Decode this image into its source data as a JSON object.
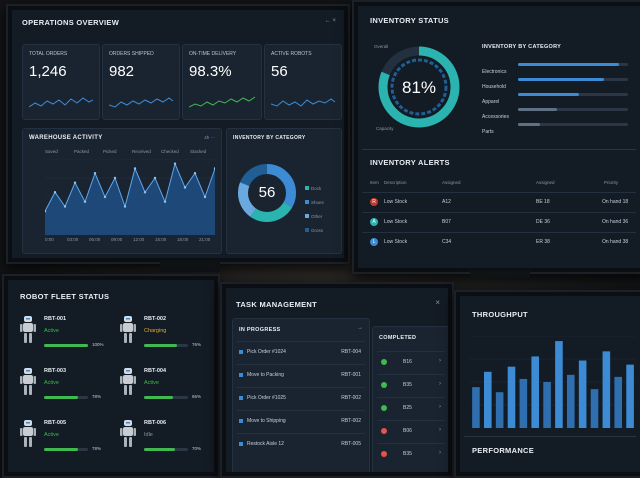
{
  "ops": {
    "title": "Operations Overview",
    "window_controls": "← ×",
    "kpis": [
      {
        "label": "Total Orders",
        "value": "1,246"
      },
      {
        "label": "Orders Shipped",
        "value": "982"
      },
      {
        "label": "On-Time Delivery",
        "value": "98.3%"
      },
      {
        "label": "Active Robots",
        "value": "56"
      }
    ],
    "activity_title": "Warehouse Activity",
    "activity_controls": "4h ⋯",
    "activity_legend": [
      "Saved",
      "Packed",
      "Picked",
      "Received",
      "Checked",
      "Stacked"
    ],
    "activity_x": [
      "0:00",
      "03:00",
      "06:00",
      "09:00",
      "12:00",
      "15:00",
      "18:00",
      "21:00"
    ],
    "activity_series": [
      5,
      9,
      6,
      11,
      7,
      13,
      8,
      12,
      6,
      14,
      9,
      12,
      7,
      15,
      10,
      13,
      8,
      14
    ],
    "donut_title": "Inventory by Category",
    "donut_value": "56",
    "donut_legend": [
      "Dock",
      "Shoes",
      "Other",
      "Gross"
    ]
  },
  "inventory": {
    "title": "Inventory Status",
    "gauge_value": "81%",
    "gauge_percent": 81,
    "gauge_top_label": "Overall",
    "gauge_bottom_label": "Capacity",
    "cat_title": "Inventory by Category",
    "categories": [
      {
        "name": "Electronics",
        "level": 0.92
      },
      {
        "name": "Household",
        "level": 0.78
      },
      {
        "name": "Apparel",
        "level": 0.55
      },
      {
        "name": "Accessories",
        "level": 0.35
      },
      {
        "name": "Parts",
        "level": 0.2
      }
    ]
  },
  "alerts": {
    "title": "Inventory Alerts",
    "headers": [
      "Item",
      "Description",
      "Assigned",
      "Assigned",
      "Priority"
    ],
    "rows": [
      {
        "badge": "R",
        "status": "Low Stock",
        "loc": "A12",
        "code": "BE 18",
        "qty": "On hand 18"
      },
      {
        "badge": "A",
        "status": "Low Stock",
        "loc": "B07",
        "code": "DE 36",
        "qty": "On hand 36"
      },
      {
        "badge": "L",
        "status": "Low Stock",
        "loc": "C34",
        "code": "ER 38",
        "qty": "On hand 38"
      }
    ]
  },
  "fleet": {
    "title": "Robot Fleet Status",
    "robots": [
      {
        "id": "RBT-001",
        "status": "Active",
        "pct": "100%",
        "level": 1.0
      },
      {
        "id": "RBT-002",
        "status": "Charging",
        "pct": "76%",
        "level": 0.76
      },
      {
        "id": "RBT-003",
        "status": "Active",
        "pct": "78%",
        "level": 0.78
      },
      {
        "id": "RBT-004",
        "status": "Active",
        "pct": "65%",
        "level": 0.65
      },
      {
        "id": "RBT-005",
        "status": "Active",
        "pct": "78%",
        "level": 0.78
      },
      {
        "id": "RBT-006",
        "status": "Idle",
        "pct": "70%",
        "level": 0.7
      }
    ]
  },
  "tasks": {
    "title": "Task Management",
    "in_progress_label": "In Progress",
    "in_progress": [
      {
        "task": "Pick Order #1024",
        "robot": "RBT-004"
      },
      {
        "task": "Move to Packing",
        "robot": "RBT-001"
      },
      {
        "task": "Pick Order #1025",
        "robot": "RBT-002"
      },
      {
        "task": "Move to Shipping",
        "robot": "RBT-002"
      },
      {
        "task": "Restock Aisle 12",
        "robot": "RBT-005"
      }
    ],
    "completed_label": "Completed",
    "completed": [
      "B16",
      "B35",
      "B25",
      "B06",
      "B35"
    ]
  },
  "throughput": {
    "title": "Throughput",
    "bars": [
      40,
      55,
      35,
      60,
      48,
      70,
      45,
      85,
      52,
      66,
      38,
      75,
      50,
      62
    ],
    "performance_label": "Performance"
  },
  "colors": {
    "accent": "#3d8bd4",
    "teal": "#2bb3b0",
    "green": "#3fb950",
    "red": "#e5534b"
  }
}
